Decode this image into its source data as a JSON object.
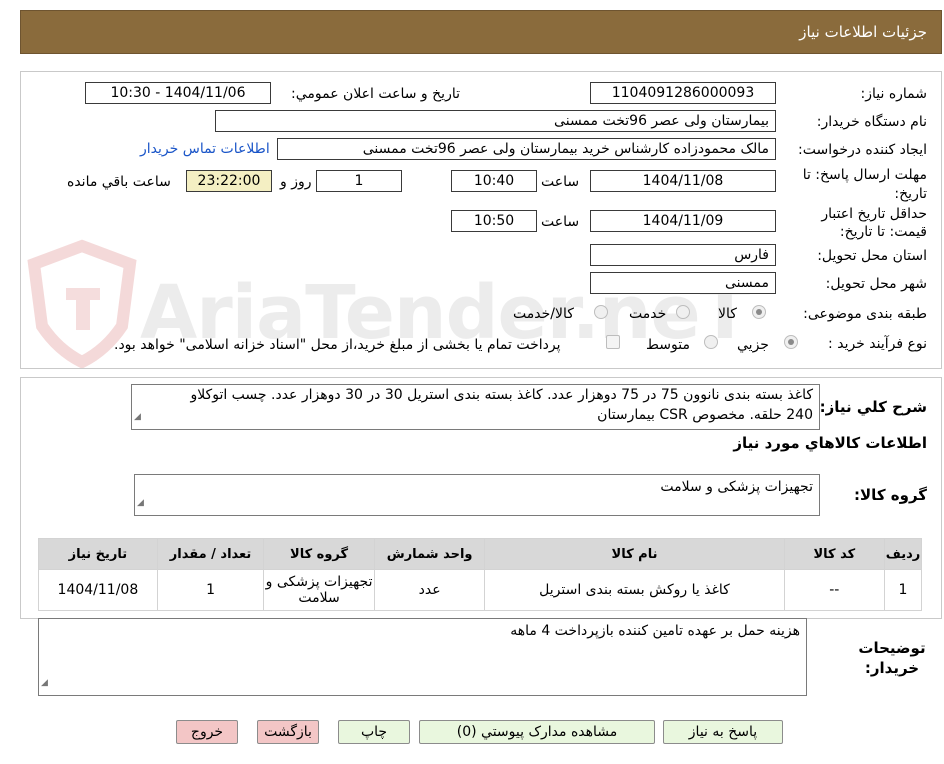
{
  "header": {
    "title": "جزئیات اطلاعات نیاز"
  },
  "watermark": {
    "text": "AriaTender.neT"
  },
  "form": {
    "need_number_label": "شماره نیاز:",
    "need_number": "1104091286000093",
    "announce_label": "تاریخ و ساعت اعلان عمومي:",
    "announce_value": "1404/11/06 - 10:30",
    "buyer_org_label": "نام دستگاه خريدار:",
    "buyer_org": "بيمارستان ولی عصر  96تخت ممسنی",
    "requester_label": "ايجاد كننده درخواست:",
    "requester": "مالک محمودزاده کارشناس خرید بیمارستان ولی عصر  96تخت ممسنی",
    "contact_link": "اطلاعات تماس خريدار",
    "deadline_label": "مهلت ارسال پاسخ: تا تاريخ:",
    "deadline_date": "1404/11/08",
    "time_label": "ساعت",
    "deadline_time": "10:40",
    "days": "1",
    "days_label": "روز و",
    "remaining_time": "23:22:00",
    "remaining_label": "ساعت باقي مانده",
    "validity_label": "حداقل تاريخ اعتبار قيمت: تا تاريخ:",
    "validity_date": "1404/11/09",
    "validity_time": "10:50",
    "province_label": "استان محل تحويل:",
    "province": "فارس",
    "city_label": "شهر محل تحويل:",
    "city": "ممسنی",
    "category_label": "طبقه بندی موضوعی:",
    "category_options": [
      "کالا",
      "خدمت",
      "کالا/خدمت"
    ],
    "process_label": "نوع فرآيند خريد :",
    "process_options": [
      "جزيي",
      "متوسط"
    ],
    "payment_note": "پرداخت تمام يا بخشی از مبلغ خريد،از محل \"اسناد خزانه اسلامی\" خواهد بود."
  },
  "description": {
    "label": "شرح كلي نياز:",
    "text_line1": "کاغذ بسته بندی نانوون 75 در 75 دوهزار عدد. کاغذ بسته بندی استریل 30 در 30 دوهزار عدد. چسب اتوکلاو",
    "text_line2": "240 حلقه. مخصوص  CSR  بیمارستان"
  },
  "goods": {
    "section_title": "اطلاعات كالاهاي مورد نياز",
    "group_label": "گروه كالا:",
    "group_value": "تجهيزات پزشكی و سلامت",
    "table": {
      "headers": [
        "رديف",
        "كد كالا",
        "نام كالا",
        "واحد شمارش",
        "گروه كالا",
        "تعداد / مقدار",
        "تاريخ نياز"
      ],
      "rows": [
        [
          "1",
          "--",
          "کاغذ یا روکش بسته بندی استریل",
          "عدد",
          "تجهيزات پزشكی و سلامت",
          "1",
          "1404/11/08"
        ]
      ]
    }
  },
  "buyer_notes": {
    "label": "توضيحات خريدار:",
    "text": "هزینه حمل بر عهده تامین کننده بازپرداخت 4 ماهه"
  },
  "buttons": {
    "reply": "پاسخ به نياز",
    "attachments": "مشاهده مدارک پیوستي (0)",
    "print": "چاپ",
    "back": "بازگشت",
    "exit": "خروج"
  }
}
